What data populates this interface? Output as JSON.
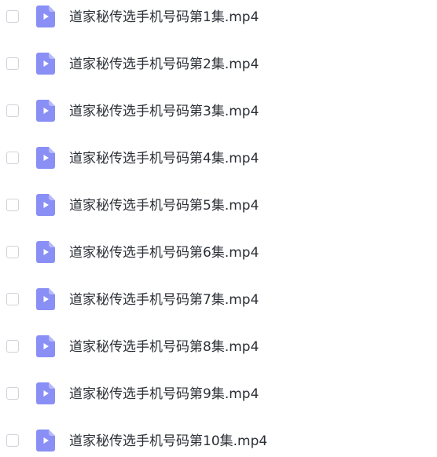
{
  "colors": {
    "file_icon": "#8a8ff5",
    "file_icon_fold": "#b7baf9",
    "play_glyph": "#ffffff",
    "checkbox_border": "#cfd3da",
    "text": "#2b2f36"
  },
  "icons": {
    "row_icon": "video-file-icon",
    "row_toggle": "checkbox"
  },
  "files": [
    {
      "name": "道家秘传选手机号码第1集.mp4",
      "checked": false
    },
    {
      "name": "道家秘传选手机号码第2集.mp4",
      "checked": false
    },
    {
      "name": "道家秘传选手机号码第3集.mp4",
      "checked": false
    },
    {
      "name": "道家秘传选手机号码第4集.mp4",
      "checked": false
    },
    {
      "name": "道家秘传选手机号码第5集.mp4",
      "checked": false
    },
    {
      "name": "道家秘传选手机号码第6集.mp4",
      "checked": false
    },
    {
      "name": "道家秘传选手机号码第7集.mp4",
      "checked": false
    },
    {
      "name": "道家秘传选手机号码第8集.mp4",
      "checked": false
    },
    {
      "name": "道家秘传选手机号码第9集.mp4",
      "checked": false
    },
    {
      "name": "道家秘传选手机号码第10集.mp4",
      "checked": false
    }
  ]
}
